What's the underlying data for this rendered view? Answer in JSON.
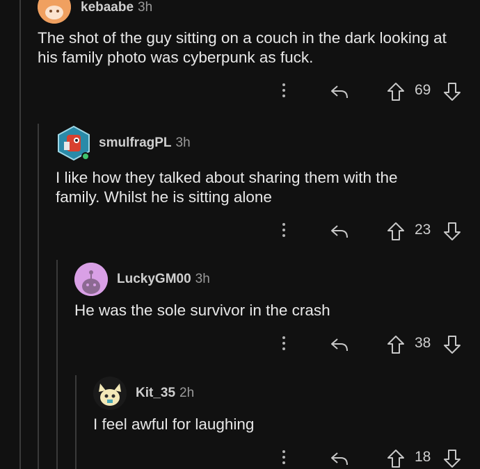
{
  "comments": [
    {
      "username": "kebaabe",
      "time": "3h",
      "body": "The shot of the guy sitting on a couch in the dark looking at his family photo was cyberpunk as fuck.",
      "votes": "69"
    },
    {
      "username": "smulfragPL",
      "time": "3h",
      "body": "I like how they talked about sharing them with the family. Whilst he is sitting alone",
      "votes": "23"
    },
    {
      "username": "LuckyGM00",
      "time": "3h",
      "body": "He was the sole survivor in the crash",
      "votes": "38"
    },
    {
      "username": "Kit_35",
      "time": "2h",
      "body": "I feel awful for laughing",
      "votes": "18"
    }
  ],
  "colors": {
    "background": "#111111",
    "thread_line": "#3a3a3a",
    "online_dot": "#3ec46d",
    "avatar_orange": "#f0a060",
    "avatar_purple": "#d9a0e6"
  }
}
